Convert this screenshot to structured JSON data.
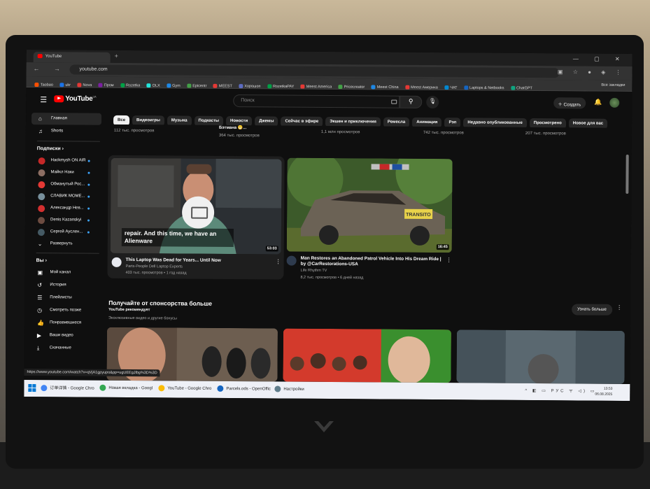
{
  "browser": {
    "tab_title": "YouTube",
    "new_tab": "+",
    "url": "youtube.com",
    "window_controls": "— ▢ ✕",
    "nav": "← → ↻",
    "bookmarks": [
      {
        "label": "Taobao",
        "color": "#ff5000"
      },
      {
        "label": "ukr",
        "color": "#1a73e8"
      },
      {
        "label": "Nova",
        "color": "#e53935"
      },
      {
        "label": "Пром",
        "color": "#7b1fa2"
      },
      {
        "label": "Rozetka",
        "color": "#00a046"
      },
      {
        "label": "OLX",
        "color": "#23e5db"
      },
      {
        "label": "Gym",
        "color": "#1e88e5"
      },
      {
        "label": "Epicentr",
        "color": "#43a047"
      },
      {
        "label": "MEEST",
        "color": "#e53935"
      },
      {
        "label": "Хорошоп",
        "color": "#5c6bc0"
      },
      {
        "label": "RozetkaPAY",
        "color": "#00a046"
      },
      {
        "label": "Meest America",
        "color": "#e53935"
      },
      {
        "label": "Pricecreator",
        "color": "#43a047"
      },
      {
        "label": "Meest China",
        "color": "#1e88e5"
      },
      {
        "label": "Meest Америка",
        "color": "#e53935"
      },
      {
        "label": "ЧАТ",
        "color": "#0288d1"
      },
      {
        "label": "Laptops & Netbooks",
        "color": "#1565c0"
      },
      {
        "label": "ChatGPT",
        "color": "#10a37f"
      }
    ],
    "all_bookmarks": "Все закладки"
  },
  "youtube": {
    "logo": "YouTube",
    "logo_region": "UA",
    "search_placeholder": "Поиск",
    "create_label": "Создать",
    "chips": [
      "Все",
      "Видеоигры",
      "Музыка",
      "Подкасты",
      "Новости",
      "Джемы",
      "Сейчас в эфире",
      "Экшен и приключения",
      "Ремесла",
      "Анимация",
      "Рэп",
      "Недавно опубликованные",
      "Просмотрено",
      "Новое для вас"
    ],
    "sidebar": {
      "main": [
        {
          "label": "Главная",
          "icon": "⌂"
        },
        {
          "label": "Shorts",
          "icon": "♫"
        }
      ],
      "subs_heading": "Подписки ›",
      "subscriptions": [
        {
          "label": "Hackmysh ON AIR",
          "color": "#c62828"
        },
        {
          "label": "Майкл Наки",
          "color": "#8d6e63"
        },
        {
          "label": "Обманутый Рос...",
          "color": "#e53935"
        },
        {
          "label": "СЛАВИК МОМЕ...",
          "color": "#78909c"
        },
        {
          "label": "Александр Нев...",
          "color": "#d32f2f"
        },
        {
          "label": "Denis Kazanskyi",
          "color": "#6d4c41"
        },
        {
          "label": "Сергей Ауслен...",
          "color": "#455a64"
        }
      ],
      "expand": "Развернуть",
      "you_heading": "Вы ›",
      "you_items": [
        {
          "label": "Мой канал",
          "icon": "▣"
        },
        {
          "label": "История",
          "icon": "↺"
        },
        {
          "label": "Плейлисты",
          "icon": "☰"
        },
        {
          "label": "Смотреть позже",
          "icon": "◷"
        },
        {
          "label": "Понравившиеся",
          "icon": "👍"
        },
        {
          "label": "Ваши видео",
          "icon": "▶"
        },
        {
          "label": "Скачанные",
          "icon": "⤓"
        }
      ]
    },
    "prev_row": [
      {
        "meta": "112 тыс. просмотров"
      },
      {
        "title": "Бэтмана 😁...",
        "meta": "364 тыс. просмотров"
      },
      {
        "meta": "1,1 млн просмотров"
      },
      {
        "meta": "742 тыс. просмотров"
      },
      {
        "meta": "207 тыс. просмотров"
      }
    ],
    "videos": [
      {
        "title": "This Laptop Was Dead for Years... Until Now",
        "channel": "Parts-People Dell Laptop Experts",
        "meta": "403 тыс. просмотров • 1 год назад",
        "duration": "53:03",
        "overlay": "repair. And this time, we have an Alienware"
      },
      {
        "title": "Man Restores an Abandoned Patrol Vehicle Into His Dream Ride | by @CarRestorations-USA",
        "channel": "Life Rhythm TV",
        "meta": "8,2 тыс. просмотров • 6 дней назад",
        "duration": "16:45",
        "car_text": "TRANSITO"
      }
    ],
    "section": {
      "title": "Получайте от спонсорства больше",
      "subtitle": "YouTube рекомендует",
      "description": "Эксклюзивные видео и другие бонусы",
      "show_more": "Узнать больше"
    },
    "status_url": "https://www.youtube.com/watch?v=qVjA1gpyupo&pp=ugUEEgJlbg%3D%3D"
  },
  "taskbar": {
    "items": [
      {
        "label": "订单详情 - Google Chro",
        "color": "#4285f4"
      },
      {
        "label": "Новая вкладка - Googl",
        "color": "#34a853"
      },
      {
        "label": "YouTube - Google Chro",
        "color": "#fbbc05"
      },
      {
        "label": "Parcels.ods - OpenOffic",
        "color": "#1565c0"
      },
      {
        "label": "Настройки",
        "color": "#607d8b"
      }
    ],
    "tray": "^ ◧ ▭ РУС ᯤ ◁) ▭",
    "time": "13:53",
    "date": "06.08.2025"
  }
}
